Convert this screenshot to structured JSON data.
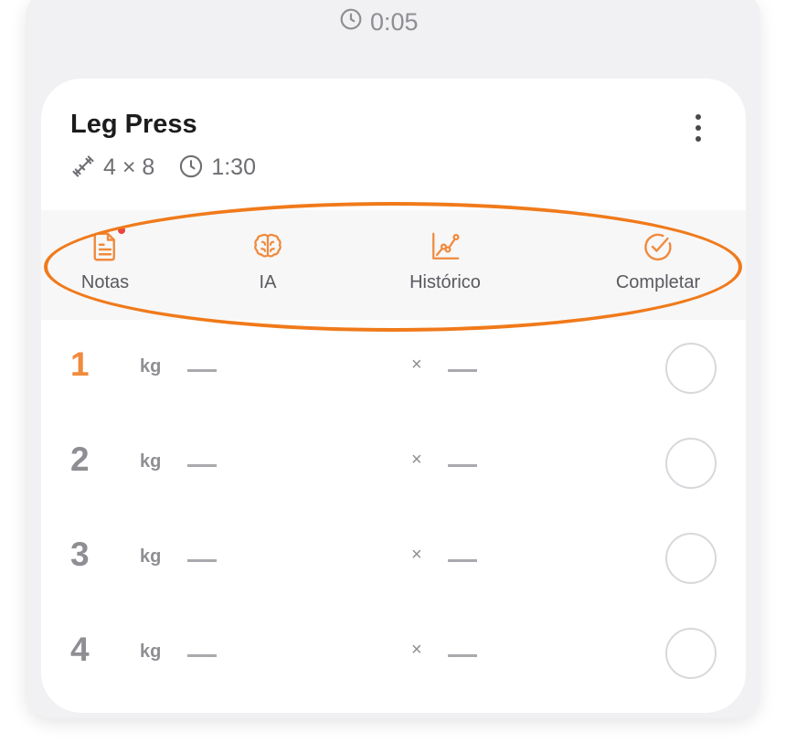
{
  "top_timer": {
    "value": "0:05",
    "icon": "clock-icon"
  },
  "exercise": {
    "title": "Leg Press",
    "sets_reps": "4 × 8",
    "rest_time": "1:30",
    "sets_icon": "dumbbell-icon",
    "rest_icon": "clock-icon",
    "menu_icon": "more-vertical-icon"
  },
  "actions": [
    {
      "label": "Notas",
      "icon": "notes-icon",
      "has_badge": true
    },
    {
      "label": "IA",
      "icon": "brain-icon"
    },
    {
      "label": "Histórico",
      "icon": "chart-line-icon"
    },
    {
      "label": "Completar",
      "icon": "check-circle-icon"
    }
  ],
  "sets": [
    {
      "number": "1",
      "weight_unit": "kg",
      "weight": "—",
      "times": "×",
      "reps": "—",
      "active": true
    },
    {
      "number": "2",
      "weight_unit": "kg",
      "weight": "—",
      "times": "×",
      "reps": "—",
      "active": false
    },
    {
      "number": "3",
      "weight_unit": "kg",
      "weight": "—",
      "times": "×",
      "reps": "—",
      "active": false
    },
    {
      "number": "4",
      "weight_unit": "kg",
      "weight": "—",
      "times": "×",
      "reps": "—",
      "active": false
    }
  ],
  "colors": {
    "accent": "#f08a3c",
    "highlight_ring": "#f07a1a",
    "badge": "#e8453c",
    "muted_text": "#8e8e93"
  }
}
